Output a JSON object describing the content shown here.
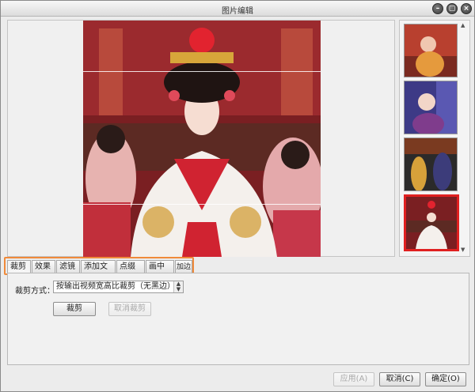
{
  "window": {
    "title": "图片编辑",
    "controls": {
      "minimize": "–",
      "maximize": "▢",
      "close": "×"
    }
  },
  "tabs": [
    {
      "label": "裁剪",
      "active": true
    },
    {
      "label": "效果",
      "active": false
    },
    {
      "label": "滤镜",
      "active": false
    },
    {
      "label": "添加文字",
      "active": false
    },
    {
      "label": "点缀图",
      "active": false
    },
    {
      "label": "画中画",
      "active": false
    },
    {
      "label": "加边框",
      "active": false
    }
  ],
  "crop": {
    "mode_label": "裁剪方式：",
    "mode_value": "按输出视频宽高比裁剪（无黑边）",
    "crop_button": "裁剪",
    "cancel_crop_button": "取消裁剪"
  },
  "footer": {
    "apply": "应用(A)",
    "cancel": "取消(C)",
    "ok": "确定(O)"
  },
  "thumbnails": {
    "count": 4,
    "selected_index": 3
  },
  "colors": {
    "accent_orange": "#f08a3a",
    "selection_red": "#e02020"
  }
}
